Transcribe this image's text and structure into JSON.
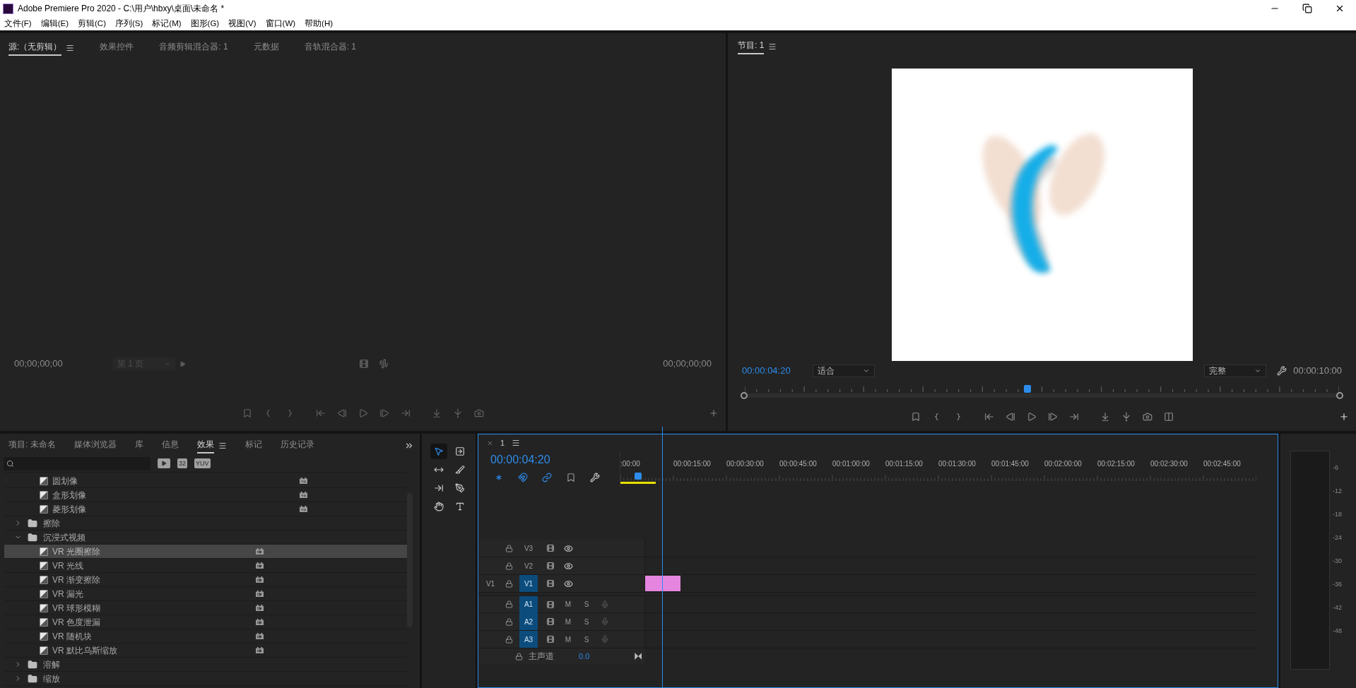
{
  "window": {
    "title": "Adobe Premiere Pro 2020 - C:\\用户\\hbxy\\桌面\\未命名 *"
  },
  "menu": [
    "文件(F)",
    "编辑(E)",
    "剪辑(C)",
    "序列(S)",
    "标记(M)",
    "图形(G)",
    "视图(V)",
    "窗口(W)",
    "帮助(H)"
  ],
  "source_panel": {
    "tabs": [
      {
        "label": "源:（无剪辑）",
        "selected": true
      },
      {
        "label": "效果控件",
        "selected": false
      },
      {
        "label": "音频剪辑混合器: 1",
        "selected": false
      },
      {
        "label": "元数据",
        "selected": false
      },
      {
        "label": "音轨混合器: 1",
        "selected": false
      }
    ],
    "timecode_in": "00;00;00;00",
    "page_dropdown": "第 1 页",
    "timecode_out": "00;00;00;00"
  },
  "program_panel": {
    "tabs": [
      {
        "label": "节目: 1",
        "selected": true
      }
    ],
    "timecode": "00:00:04:20",
    "zoom": "适合",
    "quality": "完整",
    "duration": "00:00:10:00",
    "playhead": {
      "level": 0.476
    }
  },
  "project_panel": {
    "tabs": [
      {
        "label": "项目: 未命名",
        "selected": false
      },
      {
        "label": "媒体浏览器",
        "selected": false
      },
      {
        "label": "库",
        "selected": false
      },
      {
        "label": "信息",
        "selected": false
      },
      {
        "label": "效果",
        "selected": true
      },
      {
        "label": "标记",
        "selected": false
      },
      {
        "label": "历史记录",
        "selected": false
      }
    ],
    "toolbar_badges": [
      "32",
      "YUV"
    ],
    "items": [
      {
        "kind": "effect",
        "label": "圆划像",
        "badge": {
          "kind": "yuv"
        },
        "selected": false
      },
      {
        "kind": "effect",
        "label": "盒形划像",
        "badge": {
          "kind": "yuv"
        },
        "selected": false
      },
      {
        "kind": "effect",
        "label": "菱形划像",
        "badge": {
          "kind": "yuv"
        },
        "selected": false
      },
      {
        "kind": "folder",
        "label": "擦除",
        "expanded": false
      },
      {
        "kind": "folder",
        "label": "沉浸式视频",
        "expanded": true,
        "children": [
          {
            "kind": "effect",
            "label": "VR 光圈擦除",
            "badge": {
              "kind": "accel"
            },
            "selected": true
          },
          {
            "kind": "effect",
            "label": "VR 光线",
            "badge": {
              "kind": "accel"
            },
            "selected": false
          },
          {
            "kind": "effect",
            "label": "VR 渐变擦除",
            "badge": {
              "kind": "accel"
            },
            "selected": false
          },
          {
            "kind": "effect",
            "label": "VR 漏光",
            "badge": {
              "kind": "accel"
            },
            "selected": false
          },
          {
            "kind": "effect",
            "label": "VR 球形模糊",
            "badge": {
              "kind": "accel"
            },
            "selected": false
          },
          {
            "kind": "effect",
            "label": "VR 色度泄漏",
            "badge": {
              "kind": "accel"
            },
            "selected": false
          },
          {
            "kind": "effect",
            "label": "VR 随机块",
            "badge": {
              "kind": "accel"
            },
            "selected": false
          },
          {
            "kind": "effect",
            "label": "VR 默比乌斯缩放",
            "badge": {
              "kind": "accel"
            },
            "selected": false
          }
        ]
      },
      {
        "kind": "folder",
        "label": "溶解",
        "expanded": false
      },
      {
        "kind": "folder",
        "label": "缩放",
        "expanded": false
      }
    ]
  },
  "timeline": {
    "sequence_tab": "1",
    "timecode": "00:00:04:20",
    "ruler": [
      ":00:00",
      "00:00:15:00",
      "00:00:30:00",
      "00:00:45:00",
      "00:01:00:00",
      "00:01:15:00",
      "00:01:30:00",
      "00:01:45:00",
      "00:02:00:00",
      "00:02:15:00",
      "00:02:30:00",
      "00:02:45:00"
    ],
    "playhead": {
      "level": 0.028
    },
    "tracks": [
      {
        "name": "V3",
        "kind": "video",
        "targeted": false,
        "has_clip": false
      },
      {
        "name": "V2",
        "kind": "video",
        "targeted": false,
        "has_clip": false
      },
      {
        "name": "V1",
        "kind": "video",
        "targeted": true,
        "source_patch": "V1",
        "has_clip": true
      },
      {
        "name": "A1",
        "kind": "audio",
        "targeted": true,
        "mute": "M",
        "solo": "S",
        "has_clip": false
      },
      {
        "name": "A2",
        "kind": "audio",
        "targeted": true,
        "mute": "M",
        "solo": "S",
        "has_clip": false
      },
      {
        "name": "A3",
        "kind": "audio",
        "targeted": true,
        "mute": "M",
        "solo": "S",
        "has_clip": false
      }
    ],
    "master": {
      "label": "主声道",
      "value": "0.0"
    }
  },
  "audio_meter": {
    "scale": [
      "-6",
      "-12",
      "-18",
      "-24",
      "-30",
      "-36",
      "-42",
      "-48"
    ]
  }
}
